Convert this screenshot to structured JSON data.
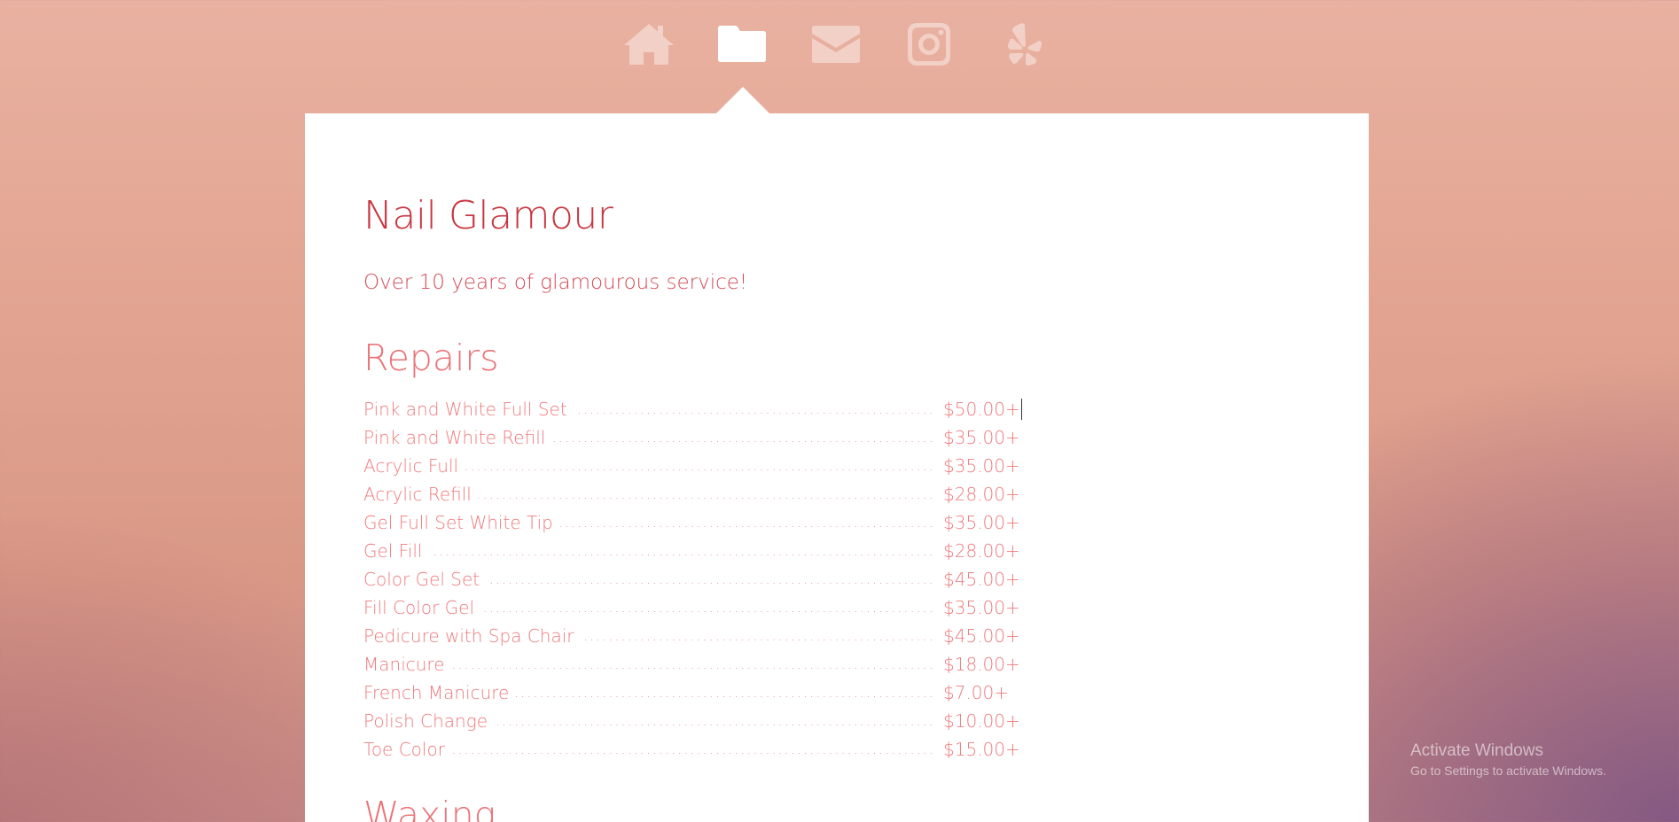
{
  "nav": {
    "items": [
      {
        "icon": "home-icon",
        "state": "inactive"
      },
      {
        "icon": "folder-icon",
        "state": "active"
      },
      {
        "icon": "envelope-icon",
        "state": "inactive"
      },
      {
        "icon": "instagram-icon",
        "state": "inactive"
      },
      {
        "icon": "yelp-icon",
        "state": "inactive"
      }
    ]
  },
  "content": {
    "title": "Nail Glamour",
    "tagline": "Over 10 years of glamourous service!",
    "sections": [
      {
        "heading": "Repairs",
        "items": [
          {
            "name": "Pink and White Full Set",
            "price": "$50.00+"
          },
          {
            "name": "Pink and White Refill",
            "price": "$35.00+"
          },
          {
            "name": "Acrylic Full",
            "price": "$35.00+"
          },
          {
            "name": "Acrylic Refill",
            "price": "$28.00+"
          },
          {
            "name": "Gel Full Set White Tip",
            "price": "$35.00+"
          },
          {
            "name": "Gel Fill",
            "price": "$28.00+"
          },
          {
            "name": "Color Gel Set",
            "price": "$45.00+"
          },
          {
            "name": "Fill Color Gel",
            "price": "$35.00+"
          },
          {
            "name": "Pedicure with Spa Chair",
            "price": "$45.00+"
          },
          {
            "name": "Manicure",
            "price": "$18.00+"
          },
          {
            "name": "French Manicure",
            "price": "$7.00+"
          },
          {
            "name": "Polish Change",
            "price": "$10.00+"
          },
          {
            "name": "Toe Color",
            "price": "$15.00+"
          }
        ]
      },
      {
        "heading": "Waxing"
      }
    ]
  },
  "watermark": {
    "title": "Activate Windows",
    "subtitle": "Go to Settings to activate Windows."
  },
  "colors": {
    "title": "#c9353f",
    "accent": "#ef7a7d",
    "card": "#ffffff"
  }
}
